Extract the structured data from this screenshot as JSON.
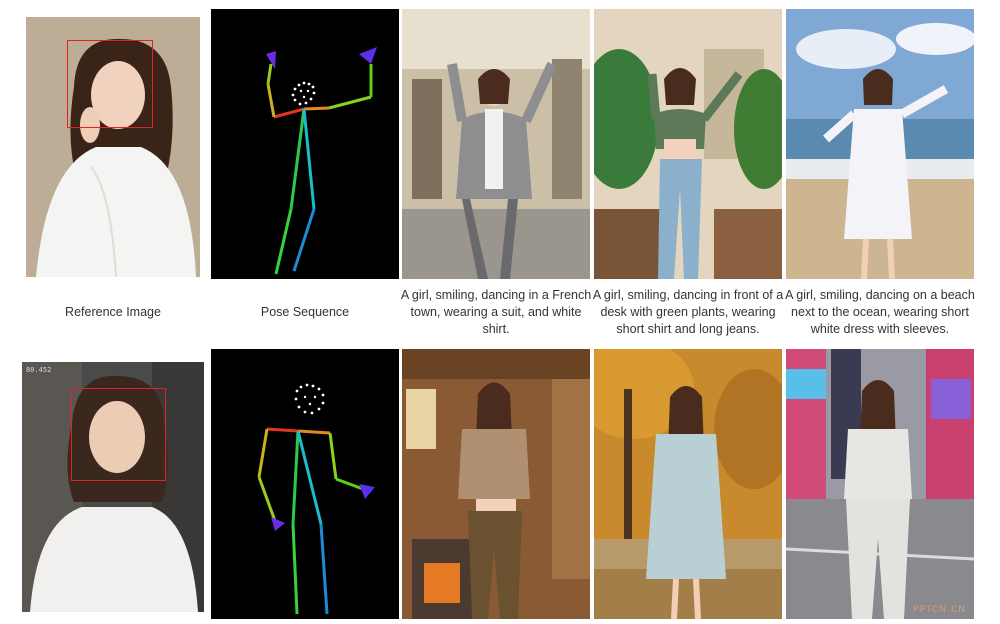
{
  "captions": {
    "row1": {
      "reference": "Reference Image",
      "pose": "Pose Sequence",
      "french_town": "A girl, smiling, dancing in a French town, wearing a suit, and white shirt.",
      "desk_plants": "A girl, smiling, dancing in front of a desk with green plants, wearing short shirt and long jeans.",
      "beach": "A girl, smiling, dancing on a beach next to the ocean, wearing short white dress with sleeves."
    }
  },
  "overlay": {
    "frame_label": "80.452"
  },
  "watermark": "PPTCN.CN",
  "colors": {
    "face_box": "#e02424",
    "pose_bg": "#000000"
  }
}
